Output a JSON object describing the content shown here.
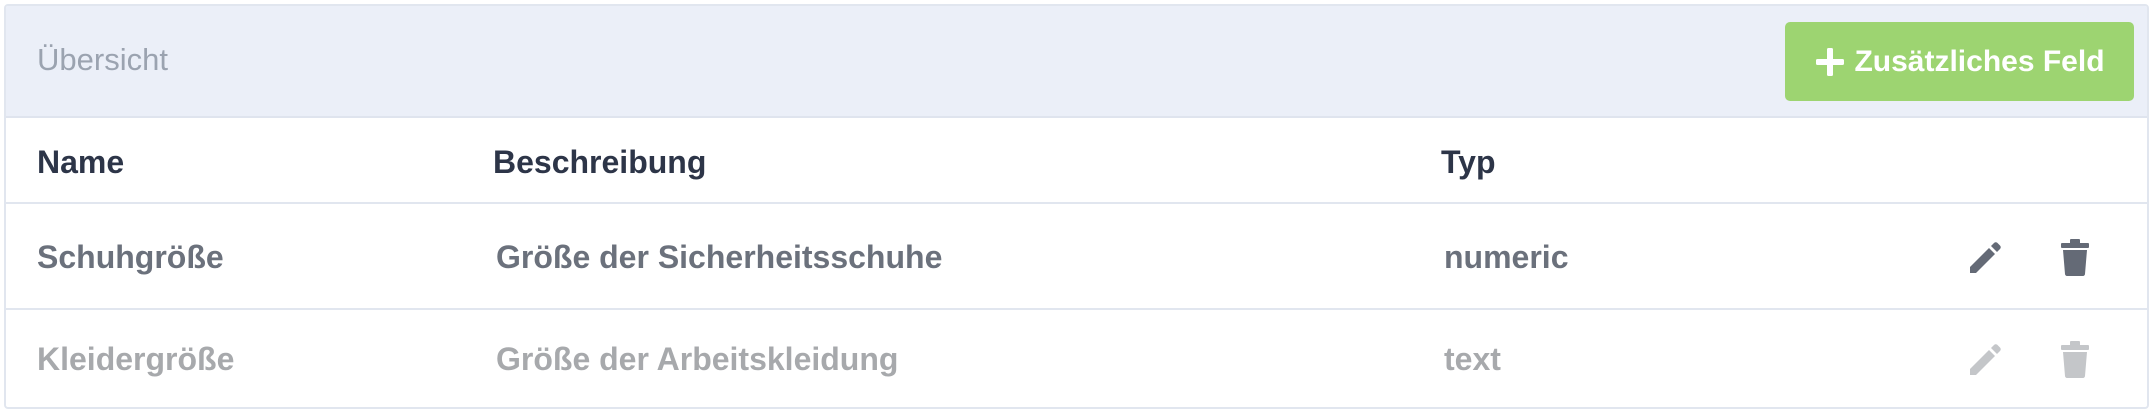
{
  "header": {
    "title": "Übersicht",
    "add_button_label": "Zusätzliches Feld"
  },
  "table": {
    "columns": [
      "Name",
      "Beschreibung",
      "Typ"
    ],
    "rows": [
      {
        "name": "Schuhgröße",
        "description": "Größe der Sicherheitsschuhe",
        "type": "numeric",
        "state": "active"
      },
      {
        "name": "Kleidergröße",
        "description": "Größe der Arbeitskleidung",
        "type": "text",
        "state": "disabled"
      }
    ]
  },
  "icons": {
    "add": "plus-icon",
    "edit": "pencil-icon",
    "delete": "trash-icon"
  },
  "colors": {
    "header_bg": "#ebeff8",
    "add_button": "#9dd471",
    "active_text": "#6b717c",
    "disabled_text": "#a7a9ac",
    "heading_text": "#2d3548"
  }
}
